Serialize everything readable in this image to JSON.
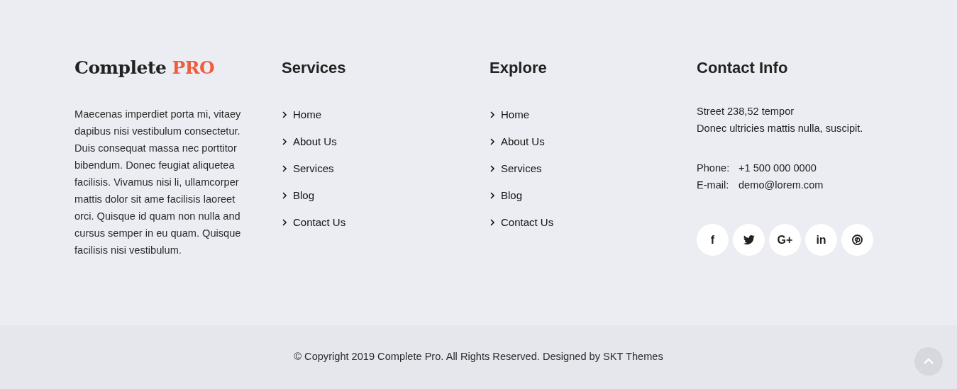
{
  "brand": {
    "name": "Complete",
    "accent": "PRO",
    "description": "Maecenas imperdiet porta mi, vitaey dapibus nisi vestibulum consectetur. Duis consequat massa nec porttitor bibendum. Donec feugiat aliquetea facilisis. Vivamus nisi li, ullamcorper mattis dolor sit ame facilisis laoreet orci. Quisque id quam non nulla and cursus semper in eu quam. Quisque facilisis nisi vestibulum."
  },
  "link_columns": [
    {
      "title": "Services",
      "links": [
        "Home",
        "About Us",
        "Services",
        "Blog",
        "Contact Us"
      ]
    },
    {
      "title": "Explore",
      "links": [
        "Home",
        "About Us",
        "Services",
        "Blog",
        "Contact Us"
      ]
    }
  ],
  "contact": {
    "title": "Contact Info",
    "address": [
      "Street 238,52 tempor",
      "Donec ultricies mattis nulla, suscipit."
    ],
    "details": [
      {
        "label": "Phone:",
        "value": "+1 500 000 0000"
      },
      {
        "label": "E-mail:",
        "value": "demo@lorem.com"
      }
    ],
    "social": [
      {
        "kind": "letter",
        "glyph": "f"
      },
      {
        "kind": "bird"
      },
      {
        "kind": "letter",
        "glyph": "G+"
      },
      {
        "kind": "letter",
        "glyph": "in"
      },
      {
        "kind": "pin"
      }
    ]
  },
  "copyright": "© Copyright 2019 Complete Pro. All Rights Reserved. Designed by SKT Themes"
}
